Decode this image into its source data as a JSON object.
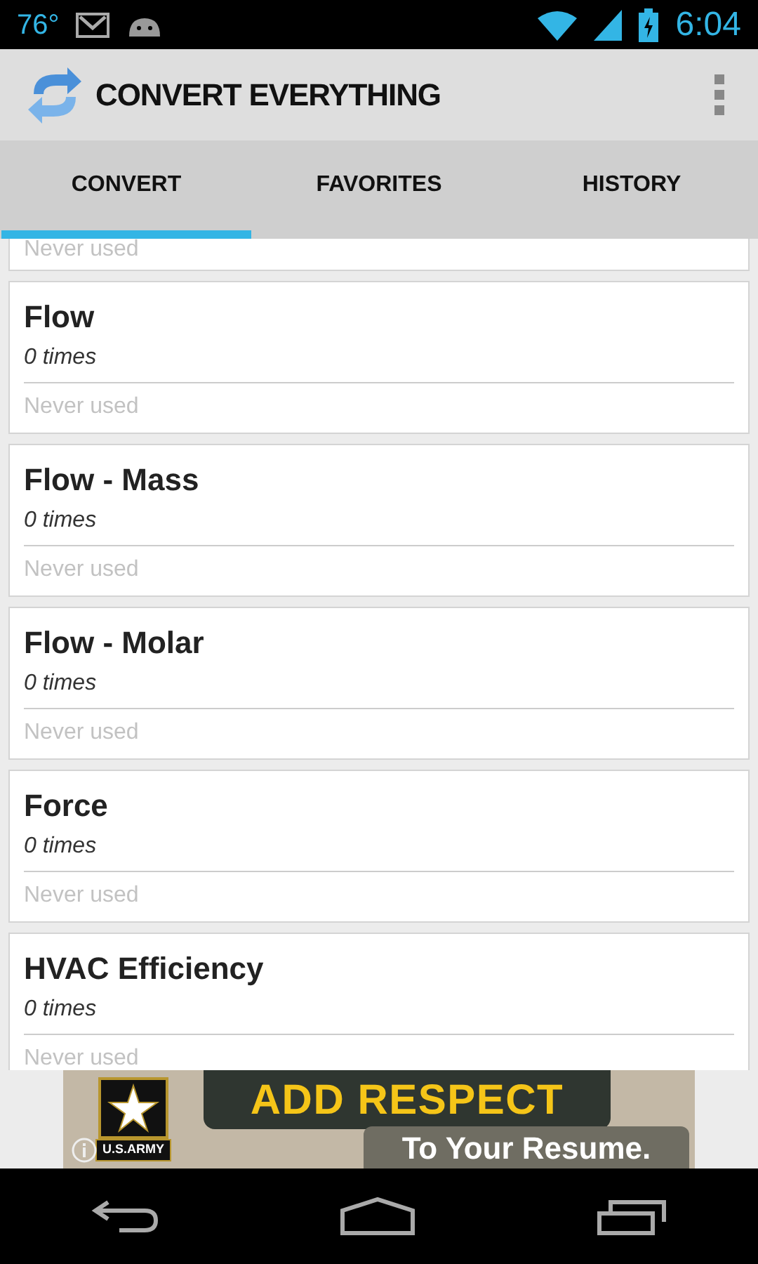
{
  "status_bar": {
    "temperature": "76°",
    "time": "6:04"
  },
  "app_bar": {
    "title": "CONVERT EVERYTHING"
  },
  "tabs": [
    {
      "label": "CONVERT",
      "selected": true
    },
    {
      "label": "FAVORITES",
      "selected": false
    },
    {
      "label": "HISTORY",
      "selected": false
    }
  ],
  "partial_item": {
    "last_used": "Never used"
  },
  "items": [
    {
      "name": "Flow",
      "count": "0 times",
      "last_used": "Never used"
    },
    {
      "name": "Flow - Mass",
      "count": "0 times",
      "last_used": "Never used"
    },
    {
      "name": "Flow - Molar",
      "count": "0 times",
      "last_used": "Never used"
    },
    {
      "name": "Force",
      "count": "0 times",
      "last_used": "Never used"
    },
    {
      "name": "HVAC Efficiency",
      "count": "0 times",
      "last_used": "Never used"
    }
  ],
  "ad": {
    "badge": "U.S.ARMY",
    "headline": "ADD RESPECT",
    "tagline": "To Your Resume."
  }
}
